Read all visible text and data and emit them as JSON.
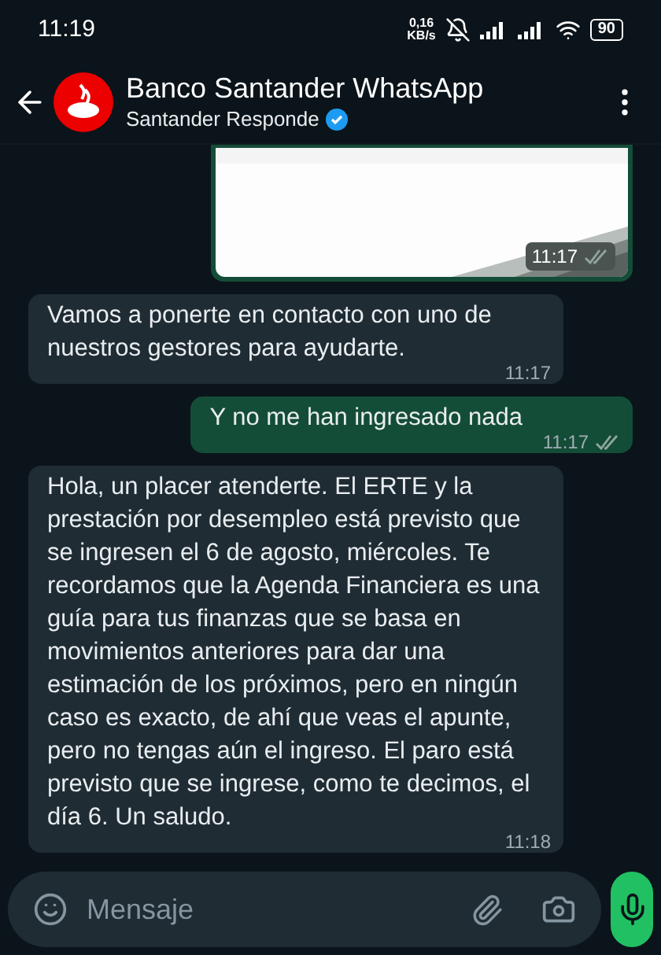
{
  "status_bar": {
    "time": "11:19",
    "network_speed": "0,16",
    "network_unit": "KB/s",
    "battery": "90"
  },
  "header": {
    "title": "Banco Santander WhatsApp",
    "subtitle": "Santander Responde",
    "verified": true
  },
  "messages": [
    {
      "outgoing": true,
      "time": "11:17"
    },
    {
      "kind": "text",
      "outgoing": false,
      "text": "Vamos a ponerte en contacto con uno de nuestros gestores para ayudarte.",
      "time": "11:17"
    },
    {
      "kind": "text",
      "outgoing": true,
      "text": "Y no me han ingresado nada",
      "time": "11:17"
    },
    {
      "kind": "text",
      "outgoing": false,
      "text": "Hola, un placer atenderte. El ERTE y la prestación por desempleo está previsto que se ingresen el 6 de agosto, miércoles. Te recordamos que la Agenda Financiera es una guía para tus finanzas que se basa en movimientos anteriores para dar una estimación de los próximos, pero en ningún caso es exacto, de ahí que veas el apunte, pero no tengas aún el ingreso. El paro está previsto que se ingrese, como te decimos, el día 6. Un saludo.",
      "time": "11:18"
    }
  ],
  "composer": {
    "placeholder": "Mensaje"
  }
}
